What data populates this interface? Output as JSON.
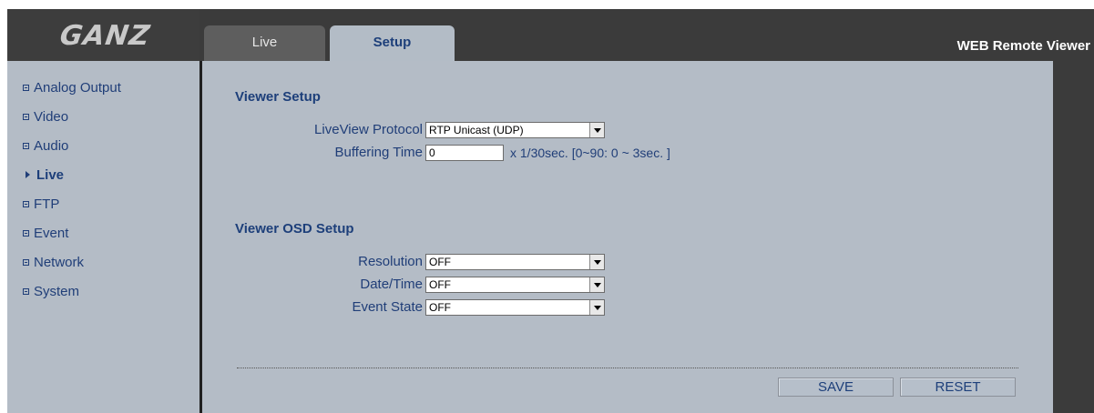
{
  "brand": {
    "logo_text": "GANZ"
  },
  "header": {
    "tabs": [
      {
        "label": "Live",
        "active": false
      },
      {
        "label": "Setup",
        "active": true
      }
    ],
    "title": "WEB Remote Viewer"
  },
  "sidebar": {
    "items": [
      {
        "label": "Analog Output",
        "icon": "expand-box-icon"
      },
      {
        "label": "Video",
        "icon": "expand-box-icon"
      },
      {
        "label": "Audio",
        "icon": "expand-box-icon"
      },
      {
        "label": "Live",
        "icon": "arrow-right-icon",
        "active": true
      },
      {
        "label": "FTP",
        "icon": "expand-box-icon"
      },
      {
        "label": "Event",
        "icon": "expand-box-icon"
      },
      {
        "label": "Network",
        "icon": "expand-box-icon"
      },
      {
        "label": "System",
        "icon": "expand-box-icon"
      }
    ]
  },
  "viewer_setup": {
    "title": "Viewer Setup",
    "protocol_label": "LiveView Protocol",
    "protocol_value": "RTP Unicast (UDP)",
    "buffering_label": "Buffering Time",
    "buffering_value": "0",
    "buffering_note": "x 1/30sec. [0~90: 0 ~ 3sec. ]"
  },
  "osd_setup": {
    "title": "Viewer OSD Setup",
    "resolution_label": "Resolution",
    "resolution_value": "OFF",
    "datetime_label": "Date/Time",
    "datetime_value": "OFF",
    "event_label": "Event State",
    "event_value": "OFF"
  },
  "actions": {
    "save_label": "SAVE",
    "reset_label": "RESET"
  },
  "colors": {
    "accent": "#1d3f7a",
    "panel": "#b4bcc6",
    "frame": "#3b3b3b"
  }
}
